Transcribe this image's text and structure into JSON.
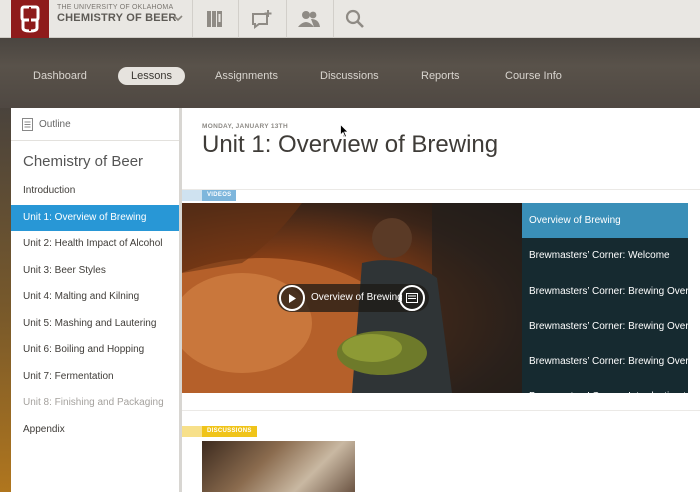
{
  "header": {
    "university": "THE UNIVERSITY OF OKLAHOMA",
    "course_name": "CHEMISTRY OF BEER",
    "logo_icon": "ou-logo-icon",
    "icons": [
      "gradebook-icon",
      "add-post-icon",
      "people-icon",
      "search-icon"
    ]
  },
  "nav": {
    "items": [
      {
        "label": "Dashboard"
      },
      {
        "label": "Lessons"
      },
      {
        "label": "Assignments"
      },
      {
        "label": "Discussions"
      },
      {
        "label": "Reports"
      },
      {
        "label": "Course Info"
      }
    ],
    "active": "Lessons"
  },
  "sidebar": {
    "outline_label": "Outline",
    "title": "Chemistry of Beer",
    "items": [
      {
        "label": "Introduction"
      },
      {
        "label": "Unit 1: Overview of Brewing"
      },
      {
        "label": "Unit 2: Health Impact of Alcohol"
      },
      {
        "label": "Unit 3: Beer Styles"
      },
      {
        "label": "Unit 4: Malting and Kilning"
      },
      {
        "label": "Unit 5: Mashing and Lautering"
      },
      {
        "label": "Unit 6: Boiling and Hopping"
      },
      {
        "label": "Unit 7: Fermentation"
      },
      {
        "label": "Unit 8: Finishing and Packaging"
      },
      {
        "label": "Appendix"
      }
    ]
  },
  "main": {
    "date": "MONDAY, JANUARY 13TH",
    "title": "Unit 1: Overview of Brewing",
    "videos_tag": "VIDEOS",
    "video_play_label": "Overview of Brewing",
    "playlist": [
      {
        "label": "Overview of Brewing"
      },
      {
        "label": "Brewmasters’ Corner: Welcome"
      },
      {
        "label": "Brewmasters’ Corner: Brewing Overvi..."
      },
      {
        "label": "Brewmasters’ Corner: Brewing Overvi..."
      },
      {
        "label": "Brewmasters’ Corner: Brewing Overvi..."
      },
      {
        "label": "Brewmasters’ Corner: Introduction to..."
      }
    ],
    "discussions_tag": "DISCUSSIONS"
  },
  "colors": {
    "brand": "#8e1b1b",
    "accent": "#2897d6",
    "playlist_active": "#3a8fb8",
    "discussions_tag": "#f0c419"
  }
}
